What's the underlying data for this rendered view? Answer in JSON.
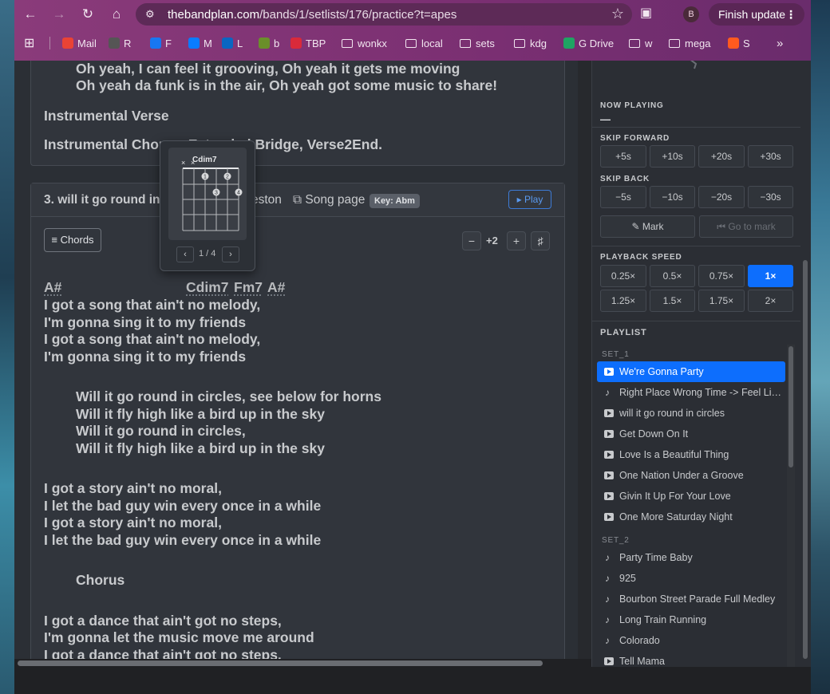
{
  "browser": {
    "url_host": "thebandplan.com",
    "url_path": "/bands/1/setlists/176/practice?t=apes",
    "profile_initial": "B",
    "finish_update": "Finish update",
    "bookmarks": [
      {
        "label": "Mail",
        "color": "#ea4335",
        "glyph": "M"
      },
      {
        "label": "R",
        "color": "#555",
        "glyph": "☺"
      },
      {
        "label": "F",
        "color": "#1877f2",
        "glyph": "f"
      },
      {
        "label": "M",
        "color": "#0a7cff",
        "glyph": "m"
      },
      {
        "label": "L",
        "color": "#0a66c2",
        "glyph": "in"
      },
      {
        "label": "b",
        "color": "#6a8f2a",
        "glyph": "b"
      },
      {
        "label": "TBP",
        "color": "#d92a3a",
        "glyph": "T"
      },
      {
        "label": "wonkx",
        "folder": true
      },
      {
        "label": "local",
        "folder": true
      },
      {
        "label": "sets",
        "folder": true
      },
      {
        "label": "kdg",
        "folder": true
      },
      {
        "label": "G Drive",
        "color": "#1fa463",
        "glyph": "▲"
      },
      {
        "label": "w",
        "folder": true
      },
      {
        "label": "mega",
        "folder": true
      },
      {
        "label": "S",
        "color": "#ff5a1f",
        "glyph": "⚡"
      }
    ]
  },
  "song_prev": {
    "lines": [
      "Oh yeah, I can feel it grooving, Oh yeah it gets me moving",
      "Oh yeah da funk is in the air, Oh yeah got some music to share!",
      "Instrumental Verse",
      "Instrumental Chorus, Extended Bridge, Verse2End."
    ]
  },
  "song": {
    "title": "3. will it go round in circles",
    "artist_partial": "eston",
    "song_page": "Song page",
    "key": "Key: Abm",
    "play": "Play",
    "chords_btn": "Chords",
    "transpose": "+2",
    "chords_row": [
      "A#",
      "Cdim7",
      "Fm7",
      "A#"
    ],
    "lines": [
      "I got a song that ain't no melody,",
      "I'm gonna sing it to my friends",
      "I got a song that ain't no melody,",
      "I'm gonna sing it to my friends",
      "Will it go round in circles, see below for horns",
      "Will it fly high like a bird up in the sky",
      "Will it go round in circles,",
      "Will it fly high like a bird up in the sky",
      "I got a story ain't no moral,",
      "I let the bad guy win every once in a while",
      "I got a story ain't no moral,",
      "I let the bad guy win every once in a while",
      "Chorus",
      "I got a dance that ain't got no steps,",
      "I'm gonna let the music move me around",
      "I got a dance that ain't got no steps,"
    ]
  },
  "chord_popup": {
    "name": "Cdim7",
    "page": "1 / 4",
    "mute": "×",
    "fingers": [
      "1",
      "2",
      "3",
      "4"
    ]
  },
  "player": {
    "now_playing": "NOW PLAYING",
    "now_value": "—",
    "skip_forward": "SKIP FORWARD",
    "skip_forward_btns": [
      "+5s",
      "+10s",
      "+20s",
      "+30s"
    ],
    "skip_back": "SKIP BACK",
    "skip_back_btns": [
      "−5s",
      "−10s",
      "−20s",
      "−30s"
    ],
    "mark": "Mark",
    "goto_mark": "Go to mark",
    "speed_label": "PLAYBACK SPEED",
    "speeds": [
      "0.25×",
      "0.5×",
      "0.75×",
      "1×",
      "1.25×",
      "1.5×",
      "1.75×",
      "2×"
    ],
    "speed_active": "1×",
    "playlist_label": "PLAYLIST",
    "set1_label": "SET_1",
    "set1": [
      {
        "title": "We're Gonna Party",
        "kind": "video"
      },
      {
        "title": "Right Place Wrong Time -> Feel Like Funkin' It Up",
        "kind": "audio"
      },
      {
        "title": "will it go round in circles",
        "kind": "video"
      },
      {
        "title": "Get Down On It",
        "kind": "video"
      },
      {
        "title": "Love Is a Beautiful Thing",
        "kind": "video"
      },
      {
        "title": "One Nation Under a Groove",
        "kind": "video"
      },
      {
        "title": "Givin It Up For Your Love",
        "kind": "video"
      },
      {
        "title": "One More Saturday Night",
        "kind": "video"
      }
    ],
    "set2_label": "SET_2",
    "set2": [
      {
        "title": "Party Time Baby",
        "kind": "audio"
      },
      {
        "title": "925",
        "kind": "audio"
      },
      {
        "title": "Bourbon Street Parade Full Medley",
        "kind": "audio"
      },
      {
        "title": "Long Train Running",
        "kind": "audio"
      },
      {
        "title": "Colorado",
        "kind": "audio"
      },
      {
        "title": "Tell Mama",
        "kind": "video"
      }
    ]
  }
}
